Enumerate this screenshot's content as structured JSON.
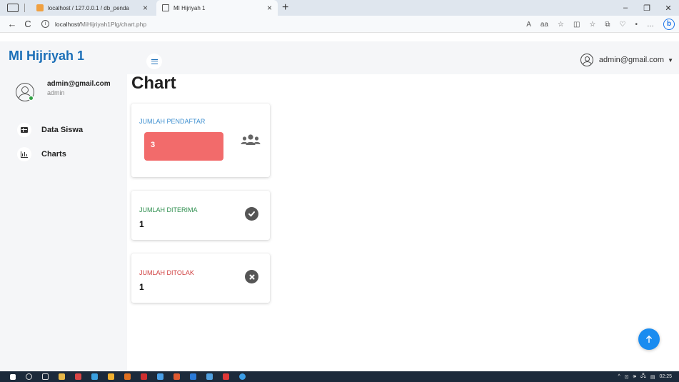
{
  "browser": {
    "tabs": [
      {
        "title": "localhost / 127.0.0.1 / db_penda",
        "close": "×",
        "active": false
      },
      {
        "title": "MI Hijriyah 1",
        "close": "×",
        "active": true
      }
    ],
    "new_tab": "+",
    "window_controls": {
      "minimize": "–",
      "restore": "❐",
      "close": "✕"
    },
    "nav": {
      "back": "←",
      "reload": "C"
    },
    "url": {
      "host": "localhost/",
      "path": "MiHijriyah1Plg/chart.php"
    },
    "toolbar_icons": [
      "A",
      "aa",
      "☆",
      "◫",
      "☆",
      "⧉",
      "♡",
      "•",
      "…"
    ],
    "profile_letter": "b"
  },
  "app": {
    "brand": "MI Hijriyah 1",
    "header_user": "admin@gmail.com"
  },
  "sidebar": {
    "user": {
      "email": "admin@gmail.com",
      "role": "admin"
    },
    "items": [
      {
        "label": "Data Siswa",
        "icon": "table-icon"
      },
      {
        "label": "Charts",
        "icon": "bar-chart-icon"
      }
    ]
  },
  "main": {
    "title": "Chart",
    "cards": [
      {
        "label": "JUMLAH PENDAFTAR",
        "value": "3",
        "icon": "users-icon",
        "color": "#3d8fd0",
        "value_bg": "#f26b6b"
      },
      {
        "label": "JUMLAH DITERIMA",
        "value": "1",
        "icon": "check-circle-icon",
        "color": "#2f8f4f"
      },
      {
        "label": "JUMLAH DITOLAK",
        "value": "1",
        "icon": "x-circle-icon",
        "color": "#d04040"
      }
    ]
  },
  "fab": {
    "icon": "arrow-up-icon",
    "color": "#1a8cf0"
  },
  "taskbar": {
    "time": "02:25",
    "tray": [
      "^",
      "⊡",
      "🕪",
      "🖧",
      "▤"
    ]
  },
  "colors": {
    "brand": "#1b6fb8",
    "sidebar_bg": "#f5f6f8"
  }
}
